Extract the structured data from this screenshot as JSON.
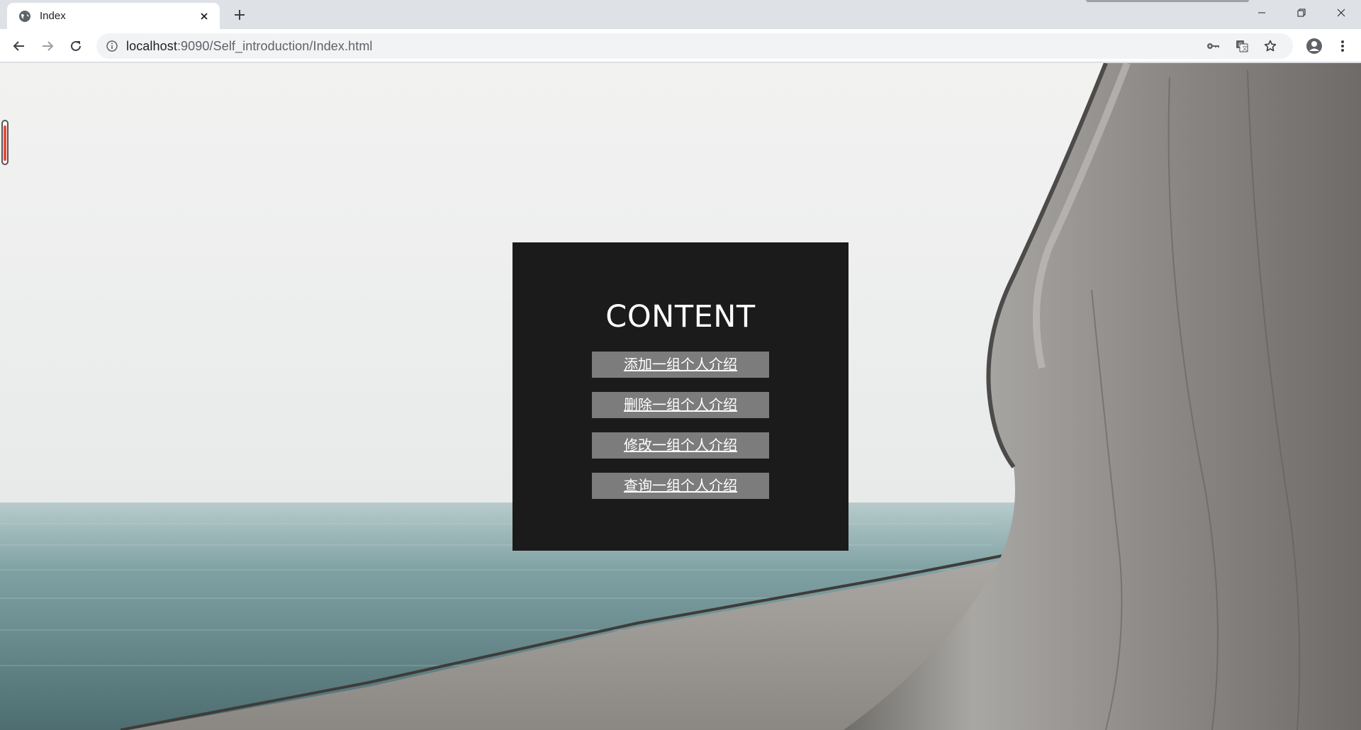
{
  "browser": {
    "tab_title": "Index",
    "url_host": "localhost",
    "url_path": ":9090/Self_introduction/Index.html"
  },
  "page": {
    "content_title": "CONTENT",
    "menu_items": [
      "添加一组个人介绍",
      "删除一组个人介绍",
      "修改一组个人介绍",
      "查询一组个人介绍"
    ]
  },
  "colors": {
    "panel": "#1b1b1b",
    "menu_button": "#7c7c7c",
    "scroll_fill": "#e84b3c"
  },
  "icons": [
    "globe-icon",
    "close-icon",
    "plus-icon",
    "minimize-icon",
    "restore-icon",
    "back-icon",
    "forward-icon",
    "reload-icon",
    "info-icon",
    "key-icon",
    "translate-icon",
    "star-icon",
    "account-icon",
    "menu-icon"
  ]
}
